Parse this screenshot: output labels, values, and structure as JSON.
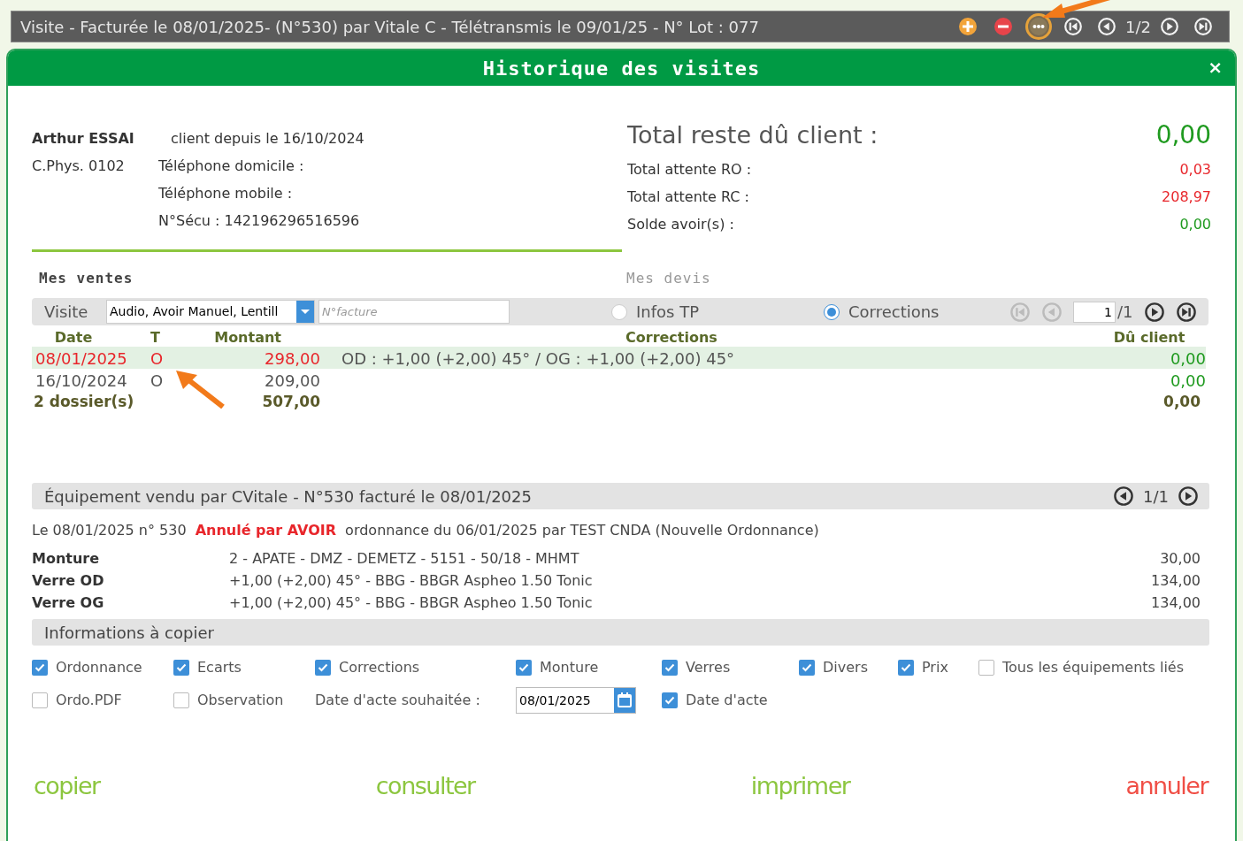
{
  "top_bar": {
    "title": "Visite - Facturée le 08/01/2025- (N°530) par Vitale C - Télétransmis le 09/01/25 - N° Lot : 077",
    "page": "1/2",
    "buttons": [
      {
        "kind": "add",
        "highlighted": false
      },
      {
        "kind": "remove",
        "highlighted": false
      },
      {
        "kind": "more",
        "highlighted": true
      },
      {
        "kind": "first",
        "highlighted": false
      },
      {
        "kind": "prev",
        "highlighted": false
      },
      {
        "kind": "next",
        "highlighted": false
      },
      {
        "kind": "last",
        "highlighted": false
      }
    ]
  },
  "dialog": {
    "title": "Historique des visites",
    "close": "×"
  },
  "client": {
    "name": "Arthur ESSAI",
    "since": "client depuis le 16/10/2024",
    "code": "C.Phys. 0102",
    "lines": [
      "Téléphone domicile :",
      "Téléphone mobile :",
      "N°Sécu : 142196296516596"
    ]
  },
  "totals": {
    "label": "Total reste dû client :",
    "value": "0,00",
    "lines": [
      {
        "label": "Total attente RO :",
        "value": "0,03",
        "color": "#e8262b"
      },
      {
        "label": "Total attente RC :",
        "value": "208,97",
        "color": "#e8262b"
      },
      {
        "label": "Solde avoir(s) :",
        "value": "0,00",
        "color": "#1f9a1f"
      }
    ]
  },
  "sections": [
    {
      "label": "Mes ventes",
      "selected": true
    },
    {
      "label": "Mes devis",
      "selected": false
    }
  ],
  "filter": {
    "label": "Visite",
    "type_value": "Audio, Avoir Manuel, Lentill",
    "invoice_placeholder": "N°facture",
    "radios": [
      {
        "label": "Infos TP",
        "selected": false
      },
      {
        "label": "Corrections",
        "selected": true
      }
    ],
    "page_value": "1",
    "page_total": "/1"
  },
  "sales": {
    "columns": [
      "Date",
      "T",
      "Montant",
      "Corrections",
      "Dû client"
    ],
    "rows": [
      {
        "date": "08/01/2025",
        "t": "O",
        "amount": "298,00",
        "corrections": "OD : +1,00 (+2,00) 45° / OG : +1,00 (+2,00) 45°",
        "due": "0,00",
        "selected": true
      },
      {
        "date": "16/10/2024",
        "t": "O",
        "amount": "209,00",
        "corrections": "",
        "due": "0,00",
        "selected": false
      }
    ],
    "total": {
      "count": "2 dossier(s)",
      "amount": "507,00",
      "due": "0,00"
    }
  },
  "equipment": {
    "title": "Équipement vendu par CVitale - N°530 facturé le 08/01/2025",
    "page": "1/1",
    "info_prefix": "Le 08/01/2025 n° 530",
    "info_alert": "Annulé par AVOIR",
    "info_suffix": "ordonnance du 06/01/2025 par TEST CNDA (Nouvelle Ordonnance)",
    "items": [
      {
        "label": "Monture",
        "description": "2 - APATE - DMZ - DEMETZ - 5151 - 50/18 - MHMT",
        "price": "30,00"
      },
      {
        "label": "Verre OD",
        "description": "+1,00 (+2,00) 45° - BBG - BBGR Aspheo 1.50 Tonic",
        "price": "134,00"
      },
      {
        "label": "Verre OG",
        "description": "+1,00 (+2,00) 45° - BBG - BBGR Aspheo 1.50 Tonic",
        "price": "134,00"
      }
    ]
  },
  "copy_info": {
    "title": "Informations à copier",
    "options": [
      {
        "kind": "checkbox",
        "label": "Ordonnance",
        "checked": true
      },
      {
        "kind": "checkbox",
        "label": "Ecarts",
        "checked": true
      },
      {
        "kind": "checkbox",
        "label": "Corrections",
        "checked": true
      },
      {
        "kind": "checkbox",
        "label": "Monture",
        "checked": true
      },
      {
        "kind": "checkbox",
        "label": "Verres",
        "checked": true
      },
      {
        "kind": "checkbox",
        "label": "Divers",
        "checked": true
      },
      {
        "kind": "checkbox",
        "label": "Prix",
        "checked": true
      },
      {
        "kind": "checkbox",
        "label": "Tous les équipements liés",
        "checked": false
      },
      {
        "kind": "checkbox",
        "label": "Ordo.PDF",
        "checked": false
      },
      {
        "kind": "checkbox",
        "label": "Observation",
        "checked": false
      },
      {
        "kind": "label",
        "label": "Date d'acte souhaitée :"
      },
      {
        "kind": "date",
        "value": "08/01/2025"
      },
      {
        "kind": "checkbox",
        "label": "Date d'acte",
        "checked": true
      }
    ]
  },
  "actions": [
    {
      "label": "copier",
      "kind": "ok"
    },
    {
      "label": "consulter",
      "kind": "ok"
    },
    {
      "label": "imprimer",
      "kind": "ok"
    },
    {
      "label": "annuler",
      "kind": "cancel"
    }
  ]
}
